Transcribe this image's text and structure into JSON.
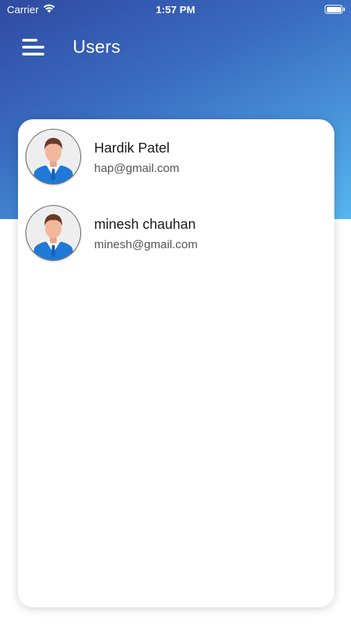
{
  "status_bar": {
    "carrier": "Carrier",
    "time": "1:57 PM",
    "wifi_icon": "wifi-icon",
    "battery_icon": "battery-icon"
  },
  "nav": {
    "title": "Users",
    "menu_icon": "hamburger-menu-icon"
  },
  "colors": {
    "header_gradient_start": "#2f4aa3",
    "header_gradient_end": "#57b6ee",
    "card_background": "#ffffff",
    "name_text": "#1b1b1b",
    "email_text": "#555555"
  },
  "users": [
    {
      "name": "Hardik Patel",
      "email": "hap@gmail.com",
      "avatar_icon": "user-avatar-icon"
    },
    {
      "name": "minesh chauhan",
      "email": "minesh@gmail.com",
      "avatar_icon": "user-avatar-icon"
    }
  ]
}
